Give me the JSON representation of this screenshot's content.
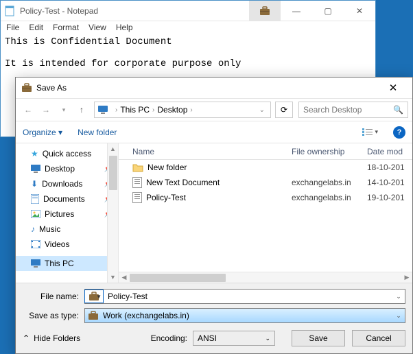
{
  "notepad": {
    "title": "Policy-Test - Notepad",
    "menu": [
      "File",
      "Edit",
      "Format",
      "View",
      "Help"
    ],
    "body": "This is Confidential Document\n\nIt is intended for corporate purpose only"
  },
  "dialog": {
    "title": "Save As",
    "nav": {
      "breadcrumbs": [
        "This PC",
        "Desktop"
      ],
      "search_placeholder": "Search Desktop"
    },
    "tools": {
      "organize": "Organize",
      "newfolder": "New folder"
    },
    "sidebar": [
      {
        "label": "Quick access",
        "icon": "star",
        "pinned": false
      },
      {
        "label": "Desktop",
        "icon": "desktop",
        "pinned": true
      },
      {
        "label": "Downloads",
        "icon": "downloads",
        "pinned": true
      },
      {
        "label": "Documents",
        "icon": "documents",
        "pinned": true
      },
      {
        "label": "Pictures",
        "icon": "pictures",
        "pinned": true
      },
      {
        "label": "Music",
        "icon": "music",
        "pinned": false
      },
      {
        "label": "Videos",
        "icon": "videos",
        "pinned": false
      },
      {
        "label": "This PC",
        "icon": "pc",
        "pinned": false,
        "selected": true
      }
    ],
    "columns": {
      "name": "Name",
      "ownership": "File ownership",
      "date": "Date mod"
    },
    "rows": [
      {
        "name": "New folder",
        "ownership": "",
        "date": "18-10-201",
        "type": "folder"
      },
      {
        "name": "New Text Document",
        "ownership": "exchangelabs.in",
        "date": "14-10-201",
        "type": "text"
      },
      {
        "name": "Policy-Test",
        "ownership": "exchangelabs.in",
        "date": "19-10-201",
        "type": "text"
      }
    ],
    "filename_label": "File name:",
    "filename_value": "Policy-Test",
    "type_label": "Save as type:",
    "type_value": "Work (exchangelabs.in)",
    "hide_folders": "Hide Folders",
    "encoding_label": "Encoding:",
    "encoding_value": "ANSI",
    "save": "Save",
    "cancel": "Cancel"
  }
}
